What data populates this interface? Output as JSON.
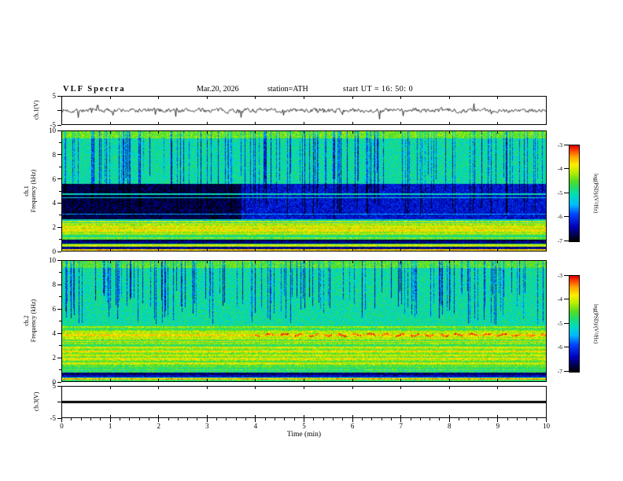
{
  "header": {
    "title": "VLF  Spectra",
    "date": "Mar.20, 2026",
    "station": "station=ATH",
    "start_ut": "start UT  =   16: 50: 0"
  },
  "x_axis": {
    "label": "Time  (min)",
    "ticks": [
      "0",
      "1",
      "2",
      "3",
      "4",
      "5",
      "6",
      "7",
      "8",
      "9",
      "10"
    ],
    "range": [
      0,
      10
    ]
  },
  "colorbar": {
    "label": "log(PSD)/(V²/Hz)",
    "ticks": [
      "-3",
      "-4",
      "-5",
      "-6",
      "-7"
    ],
    "range": [
      -7,
      -3
    ]
  },
  "colormap": {
    "stops": [
      [
        0.0,
        "#000000"
      ],
      [
        0.05,
        "#000040"
      ],
      [
        0.15,
        "#0000bb"
      ],
      [
        0.28,
        "#0044ff"
      ],
      [
        0.38,
        "#00bbff"
      ],
      [
        0.48,
        "#00ddbb"
      ],
      [
        0.56,
        "#22dd66"
      ],
      [
        0.63,
        "#55dd22"
      ],
      [
        0.72,
        "#bbee00"
      ],
      [
        0.8,
        "#ffee00"
      ],
      [
        0.88,
        "#ffaa00"
      ],
      [
        0.95,
        "#ff4400"
      ],
      [
        1.0,
        "#dd0000"
      ]
    ]
  },
  "chart_data": [
    {
      "type": "line",
      "name": "ch1_waveform",
      "ylabel": "ch.1(V)",
      "ylim": [
        -5,
        5
      ],
      "yticks": [
        {
          "v": 5,
          "label": "5"
        },
        {
          "v": 0,
          "label": ""
        },
        {
          "v": -5,
          "label": "-5"
        }
      ],
      "description": "Broadband noisy voltage trace about 0 V, typical excursions ±1.5 V with impulsive sferic spikes reaching about ±4 V",
      "seed": 7,
      "noise_amplitude": 1.3,
      "spike_rate": 0.035,
      "spike_amplitude": 2.8
    },
    {
      "type": "heatmap",
      "name": "ch1_spectrogram",
      "ylabel_line1": "ch.1",
      "ylabel_line2": "Frequency  (kHz)",
      "ylim": [
        0,
        10
      ],
      "zlim": [
        -7,
        -3
      ],
      "seed": 11,
      "noise": 0.4,
      "bands": [
        [
          9.4,
          10.01,
          -4.4
        ],
        [
          5.6,
          9.4,
          -5.0
        ],
        [
          2.6,
          5.6,
          -6.25
        ],
        [
          2.3,
          2.6,
          -5.2
        ],
        [
          1.35,
          2.3,
          -4.05
        ],
        [
          0.95,
          1.35,
          -4.7
        ],
        [
          0.6,
          0.95,
          -6.7
        ],
        [
          0.35,
          0.6,
          -4.5
        ],
        [
          0.15,
          0.35,
          -6.4
        ],
        [
          0.0,
          0.15,
          -4.1
        ]
      ],
      "dark_patch": {
        "t_max": 3.7,
        "f_low": 2.6,
        "f_high": 5.6,
        "delta": -0.55
      },
      "lines": [
        {
          "f": 4.75,
          "level": -5.1,
          "width": 0.1
        },
        {
          "f": 4.45,
          "level": -5.2,
          "width": 0.08
        },
        {
          "f": 3.05,
          "level": -5.5,
          "width": 0.08
        },
        {
          "f": 2.45,
          "level": -4.1,
          "width": 0.1
        },
        {
          "f": 1.75,
          "level": -3.8,
          "width": 0.12
        },
        {
          "f": 1.1,
          "level": -4.2,
          "width": 0.08
        },
        {
          "f": 0.45,
          "level": -3.9,
          "width": 0.1
        },
        {
          "f": 0.08,
          "level": -3.7,
          "width": 0.12
        }
      ],
      "streaks": {
        "count": 150,
        "delta_min": -0.7,
        "delta_max": -1.8,
        "f_stop_min": 2.7,
        "f_stop_max": 6.5
      },
      "stripes": {
        "f_max": 2.6,
        "amp": 0.25,
        "period": 0.32
      },
      "yticks": [
        {
          "v": 10,
          "label": "10"
        },
        {
          "v": 8,
          "label": "8"
        },
        {
          "v": 6,
          "label": "6"
        },
        {
          "v": 4,
          "label": "4"
        },
        {
          "v": 2,
          "label": "2"
        },
        {
          "v": 0,
          "label": "0"
        }
      ],
      "description": "Green background (-5) 5.6-9.4 kHz crossed by dense vertical dark-blue dropouts; dark-blue band 2.6-5.6 kHz, nearly black before 3.7 min; yellow band 1.35-2.3 kHz; alternating dark and bright narrow bands below 1 kHz"
    },
    {
      "type": "heatmap",
      "name": "ch2_spectrogram",
      "ylabel_line1": "ch.2",
      "ylabel_line2": "Frequency  (kHz)",
      "ylim": [
        0,
        10
      ],
      "zlim": [
        -7,
        -3
      ],
      "seed": 23,
      "noise": 0.4,
      "bands": [
        [
          9.4,
          10.01,
          -4.5
        ],
        [
          4.6,
          9.4,
          -5.0
        ],
        [
          4.15,
          4.6,
          -4.5
        ],
        [
          3.55,
          4.15,
          -3.95
        ],
        [
          2.9,
          3.55,
          -4.5
        ],
        [
          2.1,
          2.9,
          -4.2
        ],
        [
          1.15,
          2.1,
          -4.35
        ],
        [
          0.7,
          1.15,
          -4.9
        ],
        [
          0.3,
          0.7,
          -6.5
        ],
        [
          0.0,
          0.3,
          -4.9
        ]
      ],
      "lines": [
        {
          "f": 3.85,
          "level": -3.3,
          "width": 0.14,
          "dash": [
            0.18,
            0.12
          ],
          "wobble": 0.1,
          "t_min": 4.0
        },
        {
          "f": 3.3,
          "level": -3.9,
          "width": 0.08
        },
        {
          "f": 2.5,
          "level": -3.8,
          "width": 0.1
        },
        {
          "f": 1.9,
          "level": -3.9,
          "width": 0.08
        },
        {
          "f": 1.5,
          "level": -4.0,
          "width": 0.08
        },
        {
          "f": 0.95,
          "level": -4.4,
          "width": 0.06
        },
        {
          "f": 0.2,
          "level": -3.6,
          "width": 0.12
        }
      ],
      "streaks": {
        "count": 140,
        "delta_min": -0.7,
        "delta_max": -1.8,
        "f_stop_min": 4.7,
        "f_stop_max": 7.5
      },
      "stripes": {
        "f_max": 4.6,
        "amp": 0.28,
        "period": 0.34
      },
      "yticks": [
        {
          "v": 10,
          "label": "10"
        },
        {
          "v": 8,
          "label": "8"
        },
        {
          "v": 6,
          "label": "6"
        },
        {
          "v": 4,
          "label": "4"
        },
        {
          "v": 2,
          "label": "2"
        },
        {
          "v": 0,
          "label": "0"
        }
      ],
      "description": "Green background above 4.6 kHz with vertical blue dropouts; strong yellow-orange band 3.55-4.15 kHz with dashed red line near 3.85 kHz after 4 min; layered yellow/green horizontal bands below 3 kHz; dark band 0.3-0.7 kHz with bright red line near 0.2 kHz"
    },
    {
      "type": "line",
      "name": "ch3_flat",
      "ylabel": "ch.3(V)",
      "ylim": [
        -5,
        5
      ],
      "value": 0,
      "line_width": 3,
      "yticks": [
        {
          "v": 5,
          "label": "5"
        },
        {
          "v": 0,
          "label": ""
        },
        {
          "v": -5,
          "label": "-5"
        }
      ],
      "description": "Flat thick black line at 0 V for the whole 10 min (no signal)"
    }
  ]
}
